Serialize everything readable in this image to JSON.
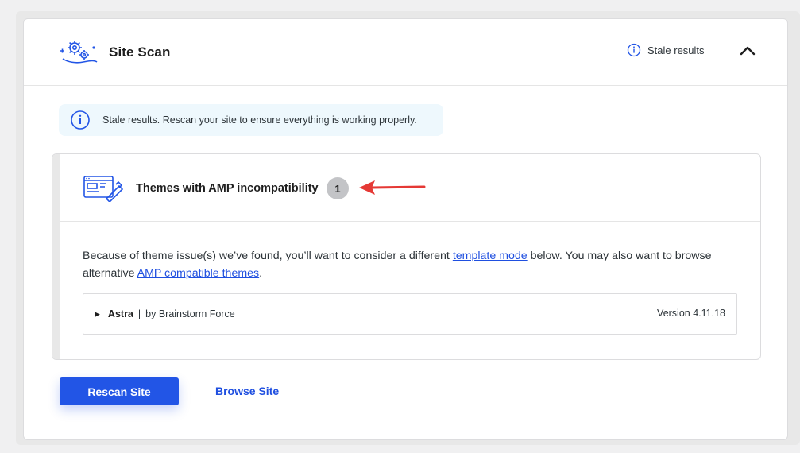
{
  "header": {
    "title": "Site Scan",
    "stale_label": "Stale results",
    "collapse_icon": "chevron-up-icon",
    "logo_icon": "gears-scan-icon"
  },
  "notice": {
    "icon": "info-icon",
    "text": "Stale results. Rescan your site to ensure everything is working properly."
  },
  "themes_card": {
    "icon": "theme-paint-icon",
    "title": "Themes with AMP incompatibility",
    "count": "1",
    "description_pre": "Because of theme issue(s) we’ve found, you’ll want to consider a different ",
    "template_mode_link": "template mode",
    "description_mid": " below. You may also want to browse alternative ",
    "compatible_themes_link": "AMP compatible themes",
    "description_post": ".",
    "theme_row": {
      "toggle": "▶",
      "name": "Astra",
      "separator": "|",
      "author": "by Brainstorm Force",
      "version": "Version 4.11.18"
    }
  },
  "actions": {
    "rescan_label": "Rescan Site",
    "browse_label": "Browse Site"
  },
  "colors": {
    "accent": "#2255e6",
    "link": "#1f4fe0",
    "notice_bg": "#eef8fd",
    "annotation_arrow": "#e53935"
  }
}
